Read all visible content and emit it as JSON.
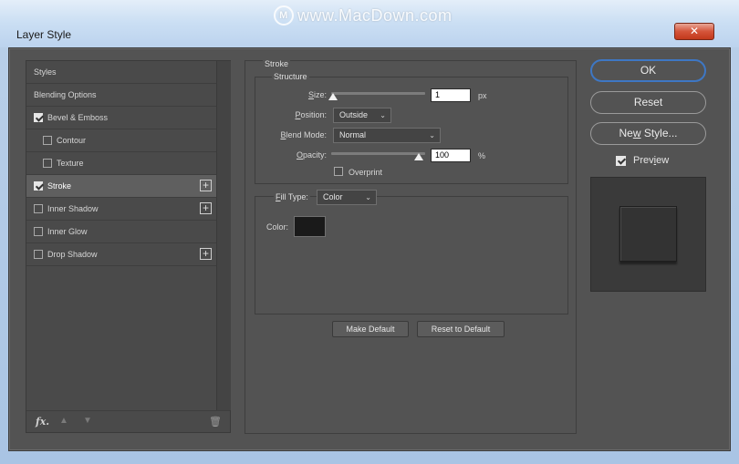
{
  "window": {
    "title": "Layer Style",
    "watermark": "www.MacDown.com",
    "watermark_logo": "M",
    "close_label": "✕"
  },
  "styles_list": {
    "items": [
      {
        "label": "Styles",
        "checkbox": false,
        "checked": false,
        "plus": false,
        "selected": false
      },
      {
        "label": "Blending Options",
        "checkbox": false,
        "checked": false,
        "plus": false,
        "selected": false
      },
      {
        "label": "Bevel & Emboss",
        "checkbox": true,
        "checked": true,
        "plus": false,
        "selected": false
      },
      {
        "label": "Contour",
        "checkbox": true,
        "checked": false,
        "plus": false,
        "selected": false,
        "indent": true
      },
      {
        "label": "Texture",
        "checkbox": true,
        "checked": false,
        "plus": false,
        "selected": false,
        "indent": true
      },
      {
        "label": "Stroke",
        "checkbox": true,
        "checked": true,
        "plus": true,
        "selected": true
      },
      {
        "label": "Inner Shadow",
        "checkbox": true,
        "checked": false,
        "plus": true,
        "selected": false
      },
      {
        "label": "Inner Glow",
        "checkbox": true,
        "checked": false,
        "plus": false,
        "selected": false
      },
      {
        "label": "Drop Shadow",
        "checkbox": true,
        "checked": false,
        "plus": true,
        "selected": false
      }
    ],
    "plus_symbol": "+",
    "footer": {
      "fx_label": "fx",
      "fx_dot": ".",
      "up_arrow": "▲",
      "down_arrow": "▼",
      "trash": "🗑"
    }
  },
  "stroke": {
    "group_title": "Stroke",
    "structure_title": "Structure",
    "size_label": "Size:",
    "size_value": "1",
    "size_unit": "px",
    "size_slider": 0,
    "position_label": "Position:",
    "position_value": "Outside",
    "blend_mode_label": "Blend Mode:",
    "blend_mode_value": "Normal",
    "opacity_label": "Opacity:",
    "opacity_value": "100",
    "opacity_unit": "%",
    "opacity_slider": 1.0,
    "overprint_label": "Overprint",
    "overprint_checked": false,
    "fill_type_label": "Fill Type:",
    "fill_type_value": "Color",
    "color_label": "Color:",
    "color_value": "#1a1a1a",
    "chevron": "⌄",
    "make_default_label": "Make Default",
    "reset_default_label": "Reset to Default"
  },
  "buttons": {
    "ok_label": "OK",
    "reset_label": "Reset",
    "new_style_label": "New Style...",
    "preview_label": "Preview",
    "preview_checked": true
  },
  "colors": {
    "panel_bg": "#535353",
    "accent_border": "#3e77c4",
    "close_red": "#c2391c"
  }
}
